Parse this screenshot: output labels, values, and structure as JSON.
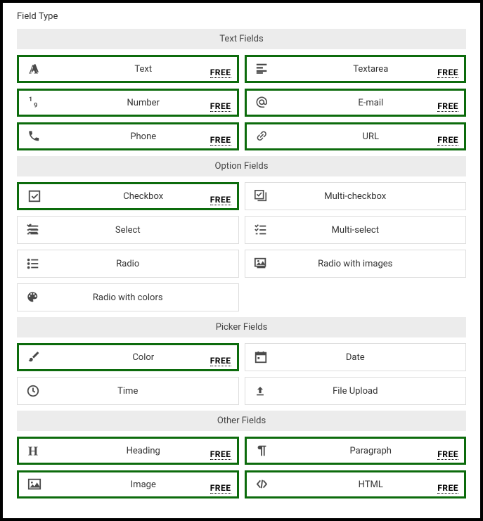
{
  "title": "Field Type",
  "badge_text": "FREE",
  "sections": [
    {
      "header": "Text Fields",
      "fields": [
        {
          "id": "text",
          "label": "Text",
          "icon": "font-icon",
          "selected": true,
          "free": true
        },
        {
          "id": "textarea",
          "label": "Textarea",
          "icon": "align-left-icon",
          "selected": true,
          "free": true
        },
        {
          "id": "number",
          "label": "Number",
          "icon": "number-icon",
          "selected": true,
          "free": true
        },
        {
          "id": "email",
          "label": "E-mail",
          "icon": "at-icon",
          "selected": true,
          "free": true
        },
        {
          "id": "phone",
          "label": "Phone",
          "icon": "phone-icon",
          "selected": true,
          "free": true
        },
        {
          "id": "url",
          "label": "URL",
          "icon": "link-icon",
          "selected": true,
          "free": true
        }
      ]
    },
    {
      "header": "Option Fields",
      "fields": [
        {
          "id": "checkbox",
          "label": "Checkbox",
          "icon": "checkbox-icon",
          "selected": true,
          "free": true
        },
        {
          "id": "multi-checkbox",
          "label": "Multi-checkbox",
          "icon": "multi-checkbox-icon",
          "selected": false,
          "free": false
        },
        {
          "id": "select",
          "label": "Select",
          "icon": "select-icon",
          "selected": false,
          "free": false
        },
        {
          "id": "multi-select",
          "label": "Multi-select",
          "icon": "multi-select-icon",
          "selected": false,
          "free": false
        },
        {
          "id": "radio",
          "label": "Radio",
          "icon": "radio-icon",
          "selected": false,
          "free": false
        },
        {
          "id": "radio-images",
          "label": "Radio with images",
          "icon": "image-radio-icon",
          "selected": false,
          "free": false
        },
        {
          "id": "radio-colors",
          "label": "Radio with colors",
          "icon": "palette-icon",
          "selected": false,
          "free": false
        }
      ]
    },
    {
      "header": "Picker Fields",
      "fields": [
        {
          "id": "color",
          "label": "Color",
          "icon": "brush-icon",
          "selected": true,
          "free": true
        },
        {
          "id": "date",
          "label": "Date",
          "icon": "calendar-icon",
          "selected": false,
          "free": false
        },
        {
          "id": "time",
          "label": "Time",
          "icon": "clock-icon",
          "selected": false,
          "free": false
        },
        {
          "id": "file",
          "label": "File Upload",
          "icon": "upload-icon",
          "selected": false,
          "free": false
        }
      ]
    },
    {
      "header": "Other Fields",
      "fields": [
        {
          "id": "heading",
          "label": "Heading",
          "icon": "heading-icon",
          "selected": true,
          "free": true
        },
        {
          "id": "paragraph",
          "label": "Paragraph",
          "icon": "paragraph-icon",
          "selected": true,
          "free": true
        },
        {
          "id": "image",
          "label": "Image",
          "icon": "image-icon",
          "selected": true,
          "free": true
        },
        {
          "id": "html",
          "label": "HTML",
          "icon": "code-icon",
          "selected": true,
          "free": true
        }
      ]
    }
  ]
}
